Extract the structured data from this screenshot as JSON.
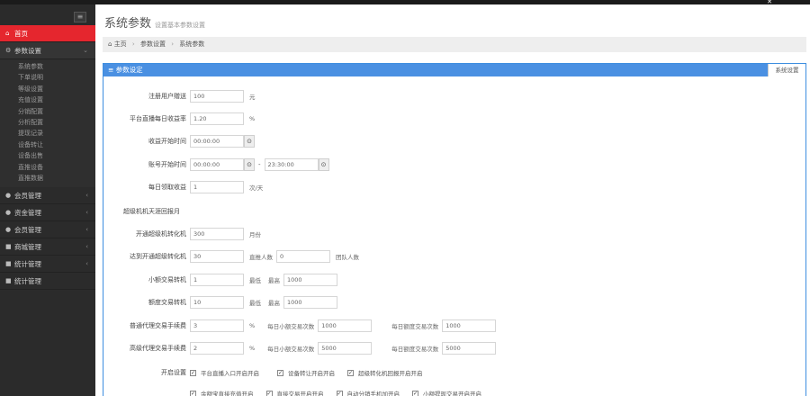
{
  "window": {
    "close": "✕"
  },
  "sidebar": {
    "toggle_icon": "≡",
    "items": [
      {
        "label": "首页",
        "icon": "home-icon",
        "glyph": "⌂"
      },
      {
        "label": "参数设置",
        "icon": "settings-icon",
        "glyph": "⚙"
      },
      {
        "label": "会员管理",
        "icon": "users-icon",
        "glyph": "●"
      },
      {
        "label": "资金管理",
        "icon": "money-icon",
        "glyph": "●"
      },
      {
        "label": "会员管理",
        "icon": "users-icon",
        "glyph": "●"
      },
      {
        "label": "商城管理",
        "icon": "shop-icon",
        "glyph": "■"
      },
      {
        "label": "统计管理",
        "icon": "stats-icon",
        "glyph": "■"
      },
      {
        "label": "统计管理",
        "icon": "stats-icon",
        "glyph": "■"
      }
    ],
    "submenu": [
      "系统参数",
      "下单说明",
      "等级设置",
      "充值设置",
      "分销配置",
      "分析配置",
      "提现记录",
      "设备转让",
      "设备出售",
      "直推设备",
      "直推数据"
    ]
  },
  "header": {
    "title": "系统参数",
    "subtitle": "设置基本参数设置"
  },
  "breadcrumb": {
    "home_icon": "⌂",
    "home": "主页",
    "sep": "›",
    "level1": "参数设置",
    "level2": "系统参数"
  },
  "panel": {
    "title": "≡ 参数设定",
    "save_label": "系统设置"
  },
  "form": {
    "r1": {
      "label": "注册用户赠送",
      "value": "100",
      "unit": "元"
    },
    "r2": {
      "label": "平台直播每日收益率",
      "value": "1.20",
      "unit": "%"
    },
    "r3": {
      "label": "收益开始时间",
      "value": "00:00:00",
      "clock": "⊙"
    },
    "r4": {
      "label": "账号开始时间",
      "start": "00:00:00",
      "dash": "-",
      "end": "23:30:00",
      "clock": "⊙"
    },
    "r5": {
      "label": "每日领取收益",
      "value": "1",
      "unit": "次/天"
    },
    "section": "超级机机天涯回报月",
    "r6": {
      "label": "开通超级机转化机",
      "value": "300",
      "unit": "月份"
    },
    "r7": {
      "label": "达到开通超级转化机",
      "value": "30",
      "mini": "直推人数",
      "value2": "0",
      "unit2": "团队人数"
    },
    "r8": {
      "label": "小额交易转机",
      "value": "1",
      "mini": "最低",
      "mini2": "最高",
      "value2": "1000"
    },
    "r9": {
      "label": "额度交易转机",
      "value": "10",
      "mini": "最低",
      "mini2": "最高",
      "value2": "1000"
    },
    "r10": {
      "label": "普通代理交易手续费",
      "value": "3",
      "unit": "%",
      "mini": "每日小额交易次数",
      "value2": "1000",
      "mini3": "每日额度交易次数",
      "value3": "1000"
    },
    "r11": {
      "label": "高级代理交易手续费",
      "value": "2",
      "unit": "%",
      "mini": "每日小额交易次数",
      "value2": "5000",
      "mini3": "每日额度交易次数",
      "value3": "5000"
    },
    "switches_label": "开启设置",
    "switches_row1": [
      "平台直播入口开启开启",
      "设备转让开启开启",
      "超级转化机回报开启开启"
    ],
    "switches_row2": [
      "余额宝直接充值开启",
      "直接交易开启开启",
      "自动分销手机加开启",
      "小额提现交易开启开启"
    ]
  }
}
